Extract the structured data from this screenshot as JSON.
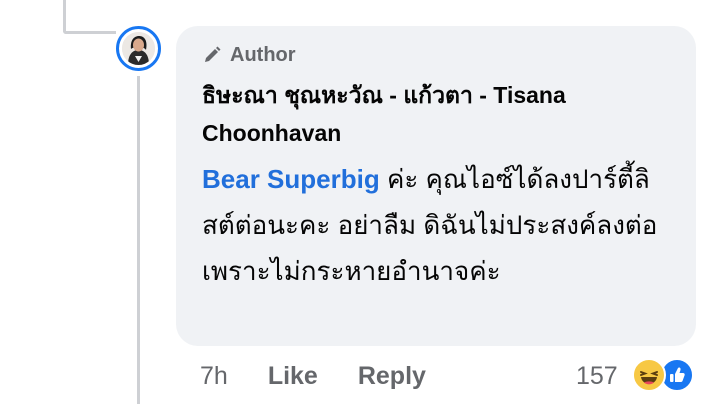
{
  "comment": {
    "badge": "Author",
    "author_name": "ธิษะณา ชุณหะวัณ - แก้วตา - Tisana Choonhavan",
    "mention": "Bear Superbig",
    "text": " ค่ะ คุณไอซ์ได้ลงปาร์ตี้ลิสต์ต่อนะคะ อย่าลืม ดิฉันไม่ประสงค์ลงต่อเพราะไม่กระหายอำนาจค่ะ"
  },
  "actions": {
    "time": "7h",
    "like_label": "Like",
    "reply_label": "Reply"
  },
  "reactions": {
    "count": "157",
    "types": [
      "haha-icon",
      "like-icon"
    ]
  },
  "colors": {
    "accent": "#1877f2",
    "mention": "#216fdb",
    "bubble": "#f0f2f5",
    "secondary_text": "#65676b"
  }
}
